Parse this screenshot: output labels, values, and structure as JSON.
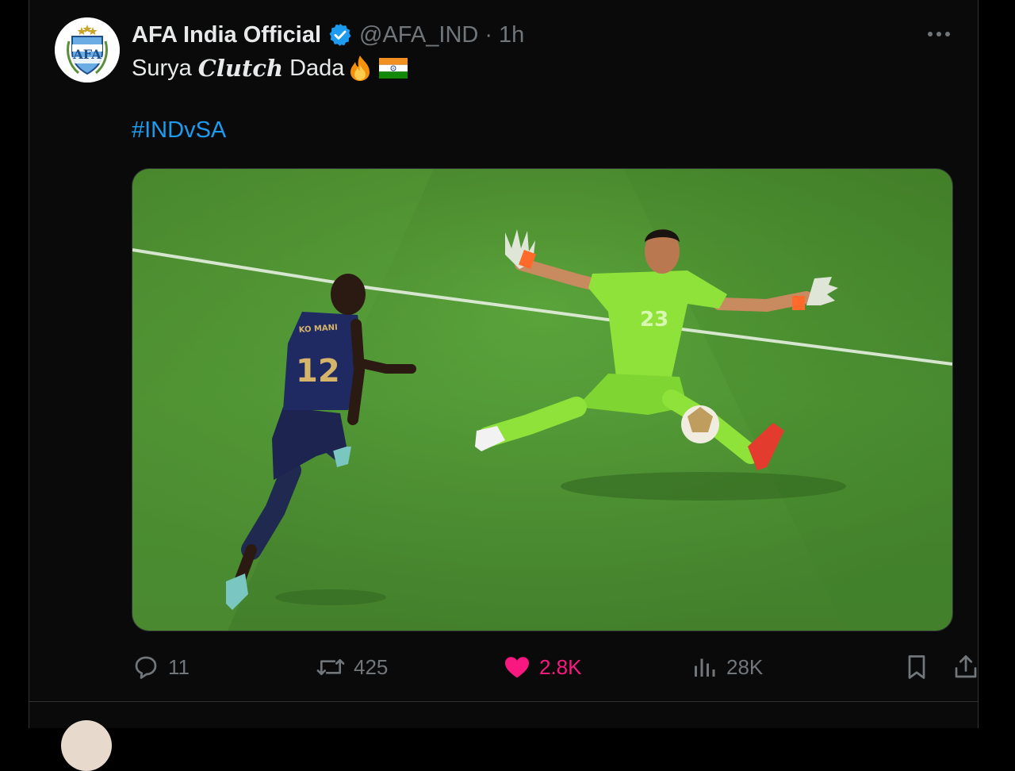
{
  "tweet": {
    "author": {
      "display_name": "AFA India Official",
      "handle": "@AFA_IND",
      "separator": "·",
      "time": "1h",
      "avatar_text": "AFA",
      "verified_color": "#1d9bf0"
    },
    "text": {
      "part1": "Surya",
      "part2": "Clutch",
      "part3": "Dada",
      "emojis": [
        "fire-icon",
        "india-flag-icon"
      ]
    },
    "hashtag": "#INDvSA",
    "media": {
      "jersey_number_attacker": "12",
      "jersey_name_attacker": "KO MANI",
      "jersey_number_keeper": "23"
    },
    "actions": {
      "replies": "11",
      "reposts": "425",
      "likes": "2.8K",
      "views": "28K"
    },
    "colors": {
      "accent": "#1d9bf0",
      "like": "#f91880",
      "muted": "#71767b"
    }
  }
}
